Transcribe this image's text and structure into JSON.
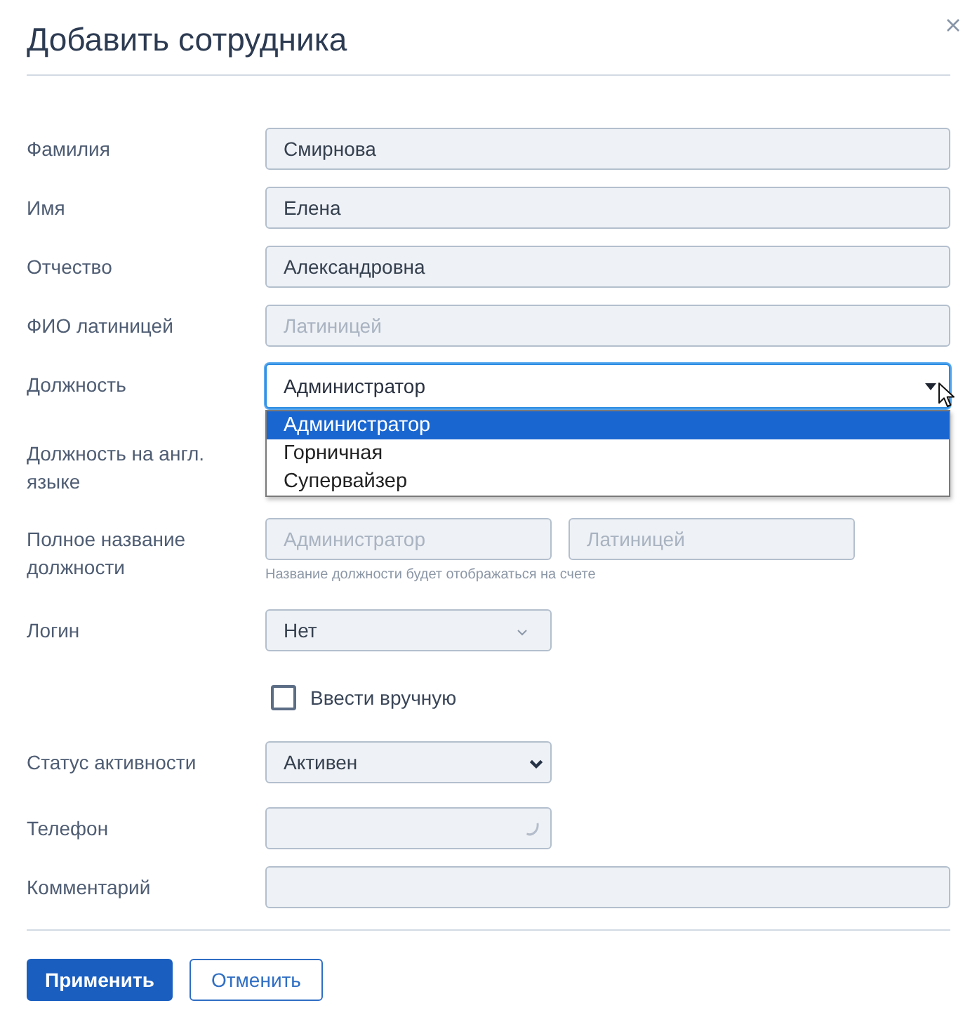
{
  "dialog": {
    "title": "Добавить сотрудника"
  },
  "fields": [
    {
      "kind": "text",
      "label": "Фамилия",
      "value": "Смирнова"
    },
    {
      "kind": "text",
      "label": "Имя",
      "value": "Елена"
    },
    {
      "kind": "text",
      "label": "Отчество",
      "value": "Александровна"
    },
    {
      "kind": "text",
      "label": "ФИО латиницей",
      "placeholder": "Латиницей"
    },
    {
      "kind": "dropdown",
      "label": "Должность",
      "value": "Администратор",
      "focused": true,
      "expanded": true,
      "options": [
        {
          "label": "Администратор",
          "selected": true
        },
        {
          "label": "Горничная",
          "selected": false
        },
        {
          "label": "Супервайзер",
          "selected": false
        }
      ]
    },
    {
      "kind": "covered",
      "label": "Должность на англ. языке"
    },
    {
      "kind": "pair",
      "label": "Полное название должности",
      "inputs": [
        {
          "placeholder": "Администратор"
        },
        {
          "placeholder": "Латиницей"
        }
      ],
      "hint": "Название должности будет отображаться на счете"
    },
    {
      "kind": "select-light",
      "label": "Логин",
      "value": "Нет"
    },
    {
      "kind": "checkbox",
      "label": "Ввести вручную",
      "checked": false
    },
    {
      "kind": "select",
      "label": "Статус активности",
      "value": "Активен"
    },
    {
      "kind": "phone",
      "label": "Телефон"
    },
    {
      "kind": "text",
      "label": "Комментарий"
    }
  ],
  "buttons": [
    {
      "kind": "primary",
      "label": "Применить"
    },
    {
      "kind": "secondary",
      "label": "Отменить"
    }
  ]
}
